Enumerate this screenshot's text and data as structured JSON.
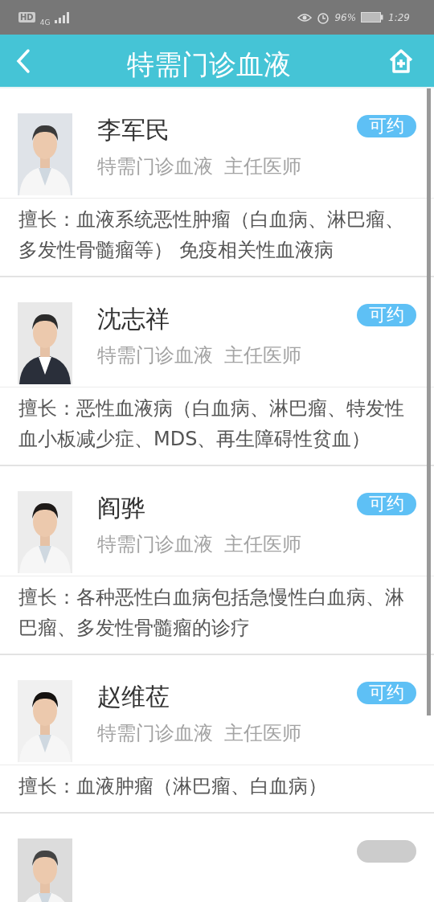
{
  "status_bar": {
    "hd": "HD",
    "network": "4G",
    "battery": "96%",
    "time": "1:29"
  },
  "header": {
    "title": "特需门诊血液"
  },
  "doctors": [
    {
      "name": "李军民",
      "department": "特需门诊血液",
      "title": "主任医师",
      "badge": "可约",
      "available": true,
      "specialty": "擅长：血液系统恶性肿瘤（白血病、淋巴瘤、多发性骨髓瘤等） 免疫相关性血液病"
    },
    {
      "name": "沈志祥",
      "department": "特需门诊血液",
      "title": "主任医师",
      "badge": "可约",
      "available": true,
      "specialty": "擅长：恶性血液病（白血病、淋巴瘤、特发性血小板减少症、MDS、再生障碍性贫血）"
    },
    {
      "name": "阎骅",
      "department": "特需门诊血液",
      "title": "主任医师",
      "badge": "可约",
      "available": true,
      "specialty": "擅长：各种恶性白血病包括急慢性白血病、淋巴瘤、多发性骨髓瘤的诊疗"
    },
    {
      "name": "赵维莅",
      "department": "特需门诊血液",
      "title": "主任医师",
      "badge": "可约",
      "available": true,
      "specialty": "擅长：血液肿瘤（淋巴瘤、白血病）"
    },
    {
      "available": false
    }
  ]
}
